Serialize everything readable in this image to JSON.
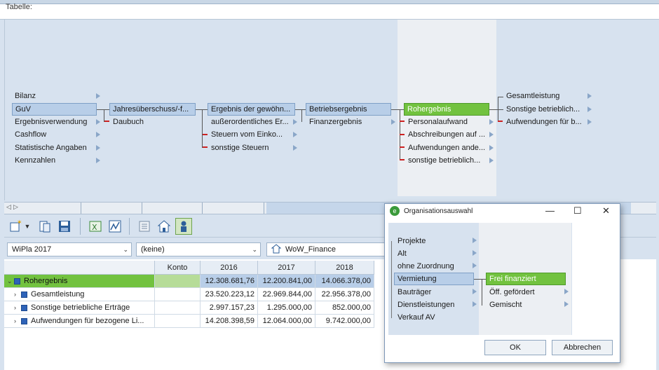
{
  "tabelle_label": "Tabelle:",
  "tree": {
    "col1": [
      "Bilanz",
      "GuV",
      "Ergebnisverwendung",
      "Cashflow",
      "Statistische Angaben",
      "Kennzahlen"
    ],
    "col2_selected": "Jahresüberschuss/-f...",
    "col2": [
      "Daubuch"
    ],
    "col3_selected": "Ergebnis der gewöhn...",
    "col3": [
      "außerordentliches Er...",
      "Steuern vom Einko...",
      "sonstige Steuern"
    ],
    "col4_selected": "Betriebsergebnis",
    "col4": [
      "Finanzergebnis"
    ],
    "col5_selected": "Rohergebnis",
    "col5": [
      "Personalaufwand",
      "Abschreibungen auf ...",
      "Aufwendungen ande...",
      "sonstige betrieblich..."
    ],
    "col6": [
      "Gesamtleistung",
      "Sonstige betrieblich...",
      "Aufwendungen für b..."
    ]
  },
  "toolbar": {
    "icons": [
      "new-doc-icon",
      "dropdown-arrow-icon",
      "copy-doc-icon",
      "save-icon",
      "excel-icon",
      "chart-icon",
      "report-icon",
      "home-icon",
      "person-icon"
    ]
  },
  "selectors": {
    "plan": "WiPla 2017",
    "filter": "(keine)",
    "entity": "WoW_Finance"
  },
  "grid": {
    "headers": [
      "Konto",
      "2016",
      "2017",
      "2018"
    ],
    "rows": [
      {
        "label": "Rohergebnis",
        "konto": "",
        "v2016": "12.308.681,76",
        "v2017": "12.200.841,00",
        "v2018": "14.066.378,00",
        "highlight": true,
        "expanded": true
      },
      {
        "label": "Gesamtleistung",
        "konto": "",
        "v2016": "23.520.223,12",
        "v2017": "22.969.844,00",
        "v2018": "22.956.378,00"
      },
      {
        "label": "Sonstige betriebliche Erträge",
        "konto": "",
        "v2016": "2.997.157,23",
        "v2017": "1.295.000,00",
        "v2018": "852.000,00"
      },
      {
        "label": "Aufwendungen für bezogene Li...",
        "konto": "",
        "v2016": "14.208.398,59",
        "v2017": "12.064.000,00",
        "v2018": "9.742.000,00"
      }
    ]
  },
  "dialog": {
    "title": "Organisationsauswahl",
    "list": [
      "Projekte",
      "Alt",
      "ohne Zuordnung",
      "Vermietung",
      "Bauträger",
      "Dienstleistungen",
      "Verkauf AV"
    ],
    "selected": "Vermietung",
    "sublist_selected": "Frei finanziert",
    "sublist": [
      "Öff. gefördert",
      "Gemischt"
    ],
    "ok_label": "OK",
    "cancel_label": "Abbrechen"
  }
}
